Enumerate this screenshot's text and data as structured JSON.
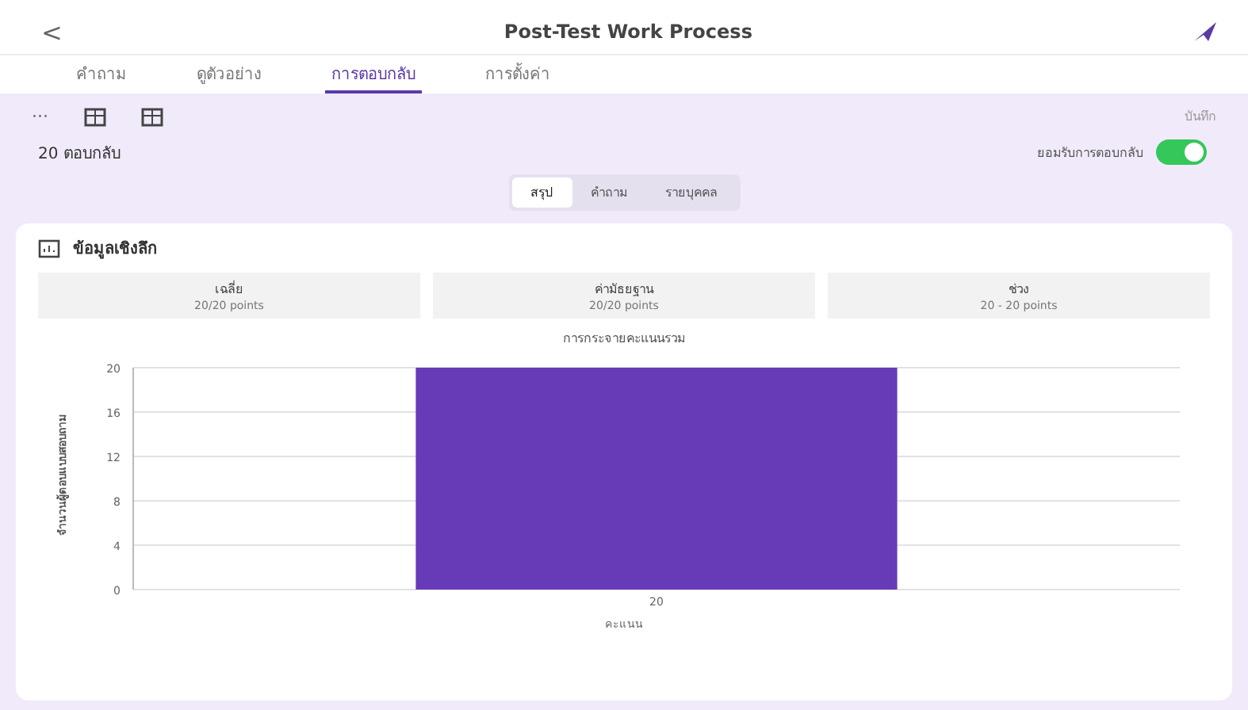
{
  "header": {
    "back": "<",
    "title": "Post-Test Work Process"
  },
  "tabs": [
    {
      "label": "คำถาม",
      "selected": false
    },
    {
      "label": "ดูตัวอย่าง",
      "selected": false
    },
    {
      "label": "การตอบกลับ",
      "selected": true
    },
    {
      "label": "การตั้งค่า",
      "selected": false
    }
  ],
  "toolbar": {
    "more": "···",
    "action": "บันทึก"
  },
  "summary": {
    "count": "20 ตอบกลับ",
    "accepting_label": "ยอมรับการตอบกลับ",
    "accepting": true
  },
  "views": [
    {
      "label": "สรุป",
      "selected": true
    },
    {
      "label": "คำถาม",
      "selected": false
    },
    {
      "label": "รายบุคคล",
      "selected": false
    }
  ],
  "insights": {
    "title": "ข้อมูลเชิงลึก",
    "stats": [
      {
        "label": "เฉลี่ย",
        "value": "20/20 points"
      },
      {
        "label": "ค่ามัธยฐาน",
        "value": "20/20 points"
      },
      {
        "label": "ช่วง",
        "value": "20 - 20 points"
      }
    ],
    "chart_data": {
      "type": "bar",
      "title": "การกระจายคะแนนรวม",
      "xlabel": "คะแนน",
      "ylabel": "จำนวนผู้ตอบแบบสอบถาม",
      "categories": [
        "20"
      ],
      "values": [
        20
      ],
      "grid": true,
      "ylim": [
        0,
        20
      ],
      "yticks": [
        0,
        4,
        8,
        12,
        16,
        20
      ]
    }
  }
}
